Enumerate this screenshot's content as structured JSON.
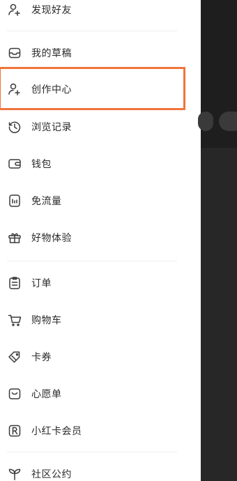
{
  "menu": {
    "items": [
      {
        "label": "发现好友",
        "icon": "add-friend-icon"
      },
      {
        "label": "我的草稿",
        "icon": "drafts-icon"
      },
      {
        "label": "创作中心",
        "icon": "creator-center-icon"
      },
      {
        "label": "浏览记录",
        "icon": "history-clock-icon"
      },
      {
        "label": "钱包",
        "icon": "wallet-icon"
      },
      {
        "label": "免流量",
        "icon": "free-data-icon"
      },
      {
        "label": "好物体验",
        "icon": "gift-icon"
      },
      {
        "label": "订单",
        "icon": "order-clipboard-icon"
      },
      {
        "label": "购物车",
        "icon": "shopping-cart-icon"
      },
      {
        "label": "卡券",
        "icon": "coupon-tag-icon"
      },
      {
        "label": "心愿单",
        "icon": "wishlist-icon"
      },
      {
        "label": "小红卡会员",
        "icon": "membership-r-icon"
      },
      {
        "label": "社区公约",
        "icon": "sprout-icon"
      }
    ]
  },
  "colors": {
    "highlight": "#f0743a",
    "icon_stroke": "#3a3a3a",
    "text": "#2a2a2a"
  }
}
